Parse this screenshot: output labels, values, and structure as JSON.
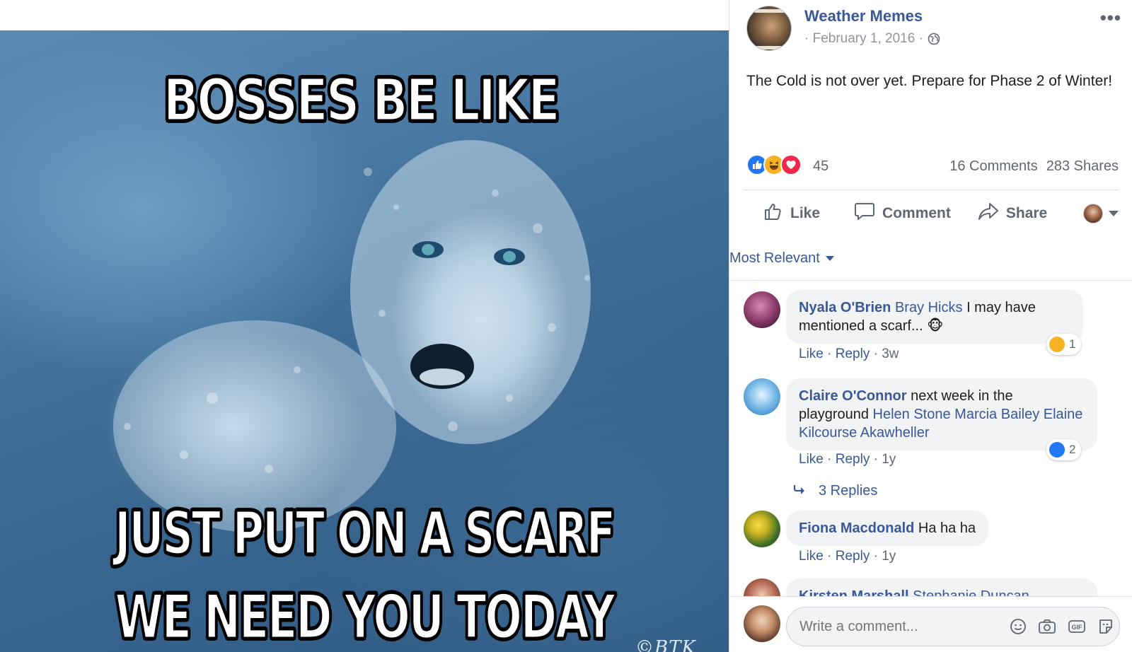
{
  "photo": {
    "meme_top": "BOSSES BE LIKE",
    "meme_middle": "JUST PUT ON A SCARF",
    "meme_bottom": "WE NEED YOU TODAY",
    "watermark": "©BTK"
  },
  "post": {
    "page_name": "Weather Memes",
    "date": "· February 1, 2016 ·",
    "caption": "The Cold is not over yet. Prepare for Phase 2 of Winter!",
    "reaction_count": "45",
    "comments_count": "16 Comments",
    "shares_count": "283 Shares",
    "reaction_icons": [
      "like-icon",
      "haha-icon",
      "love-icon"
    ]
  },
  "actions": {
    "like": "Like",
    "comment": "Comment",
    "share": "Share"
  },
  "sort": {
    "label": "Most Relevant"
  },
  "comments": [
    {
      "author": "Nyala O'Brien",
      "tag": "Bray Hicks",
      "text": " I may have mentioned a scarf... 🐵",
      "like": "Like",
      "reply": "Reply",
      "time": "3w",
      "reaction_count": "1",
      "reaction_icon": "haha-icon"
    },
    {
      "author": "Claire O'Connor",
      "text": " next week in the playground ",
      "tags": "Helen Stone Marcia Bailey Elaine Kilcourse Akawheller",
      "like": "Like",
      "reply": "Reply",
      "time": "1y",
      "reaction_count": "2",
      "reaction_icon": "like-icon"
    },
    {
      "replies": "3 Replies"
    },
    {
      "author": "Fiona Macdonald",
      "text": " Ha ha ha",
      "like": "Like",
      "reply": "Reply",
      "time": "1y"
    },
    {
      "author": "Kirsten Marshall",
      "tag": "Stephanie Duncan"
    }
  ],
  "composer": {
    "placeholder": "Write a comment...",
    "icons": [
      "emoji-icon",
      "camera-icon",
      "gif-icon",
      "sticker-icon"
    ]
  },
  "colors": {
    "link_blue": "#385898",
    "like_blue": "#2078f4",
    "haha_yellow": "#f7b125",
    "love_red": "#f0284a"
  }
}
